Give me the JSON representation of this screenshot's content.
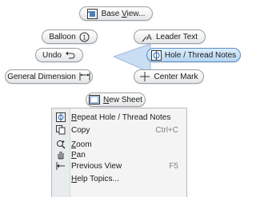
{
  "marking_menu": {
    "base_view": {
      "prefix": "Base ",
      "underline": "V",
      "suffix": "iew..."
    },
    "balloon": "Balloon",
    "leader_text": "Leader Text",
    "undo": "Undo",
    "hole_thread_notes": "Hole / Thread Notes",
    "general_dimension": "General Dimension",
    "center_mark": "Center Mark",
    "new_sheet": {
      "underline": "N",
      "suffix": "ew Sheet"
    }
  },
  "context_menu": {
    "items": [
      {
        "underline": "R",
        "label": "epeat Hole / Thread Notes",
        "shortcut": "",
        "icon": "hole-notes-icon"
      },
      {
        "underline": "",
        "label": "Copy",
        "shortcut": "Ctrl+C",
        "icon": "copy-icon"
      },
      {
        "underline": "Z",
        "label": "oom",
        "shortcut": "",
        "icon": "zoom-icon"
      },
      {
        "underline": "P",
        "label": "an",
        "shortcut": "",
        "icon": "pan-icon"
      },
      {
        "underline": "",
        "label": "Previous View",
        "shortcut": "F5",
        "icon": "previous-view-icon"
      },
      {
        "underline": "H",
        "label": "elp Topics...",
        "shortcut": "",
        "icon": ""
      }
    ]
  },
  "colors": {
    "active_fill": "#b6d6f2",
    "active_border": "#5b8fc7"
  }
}
